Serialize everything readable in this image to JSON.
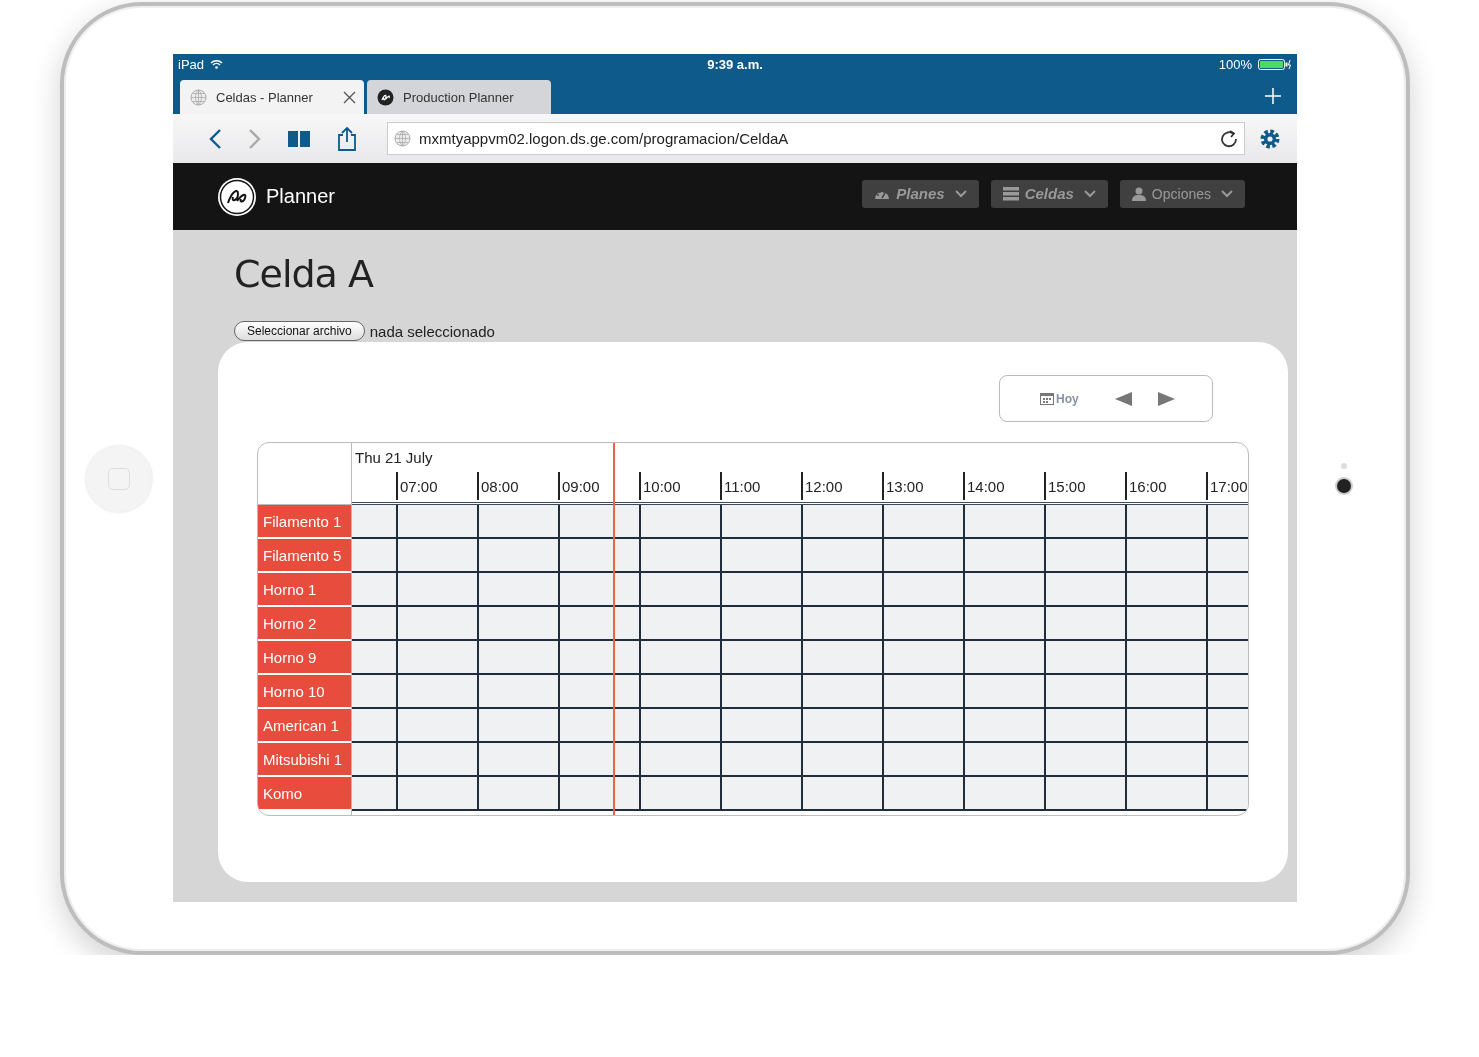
{
  "status_bar": {
    "carrier": "iPad",
    "time": "9:39 a.m.",
    "battery": "100%"
  },
  "browser_tabs": [
    {
      "label": "Celdas - Planner",
      "selected": true
    },
    {
      "label": "Production Planner",
      "selected": false
    }
  ],
  "address_bar": {
    "url": "mxmtyappvm02.logon.ds.ge.com/programacion/CeldaA"
  },
  "app": {
    "name": "Planner"
  },
  "nav_menus": [
    {
      "label": "Planes",
      "highlighted": true
    },
    {
      "label": "Celdas",
      "highlighted": true
    },
    {
      "label": "Opciones",
      "highlighted": false
    }
  ],
  "page_title": "Celda A",
  "file_input": {
    "button": "Seleccionar archivo",
    "status": "nada seleccionado"
  },
  "calendar_toolbar": {
    "today": "Hoy"
  },
  "timeline": {
    "date": "Thu 21 July",
    "hours": [
      "07:00",
      "08:00",
      "09:00",
      "10:00",
      "11:00",
      "12:00",
      "13:00",
      "14:00",
      "15:00",
      "16:00",
      "17:00"
    ],
    "resources": [
      "Filamento 1",
      "Filamento 5",
      "Horno 1",
      "Horno 2",
      "Horno 9",
      "Horno 10",
      "American 1",
      "Mitsubishi 1",
      "Komo"
    ]
  }
}
